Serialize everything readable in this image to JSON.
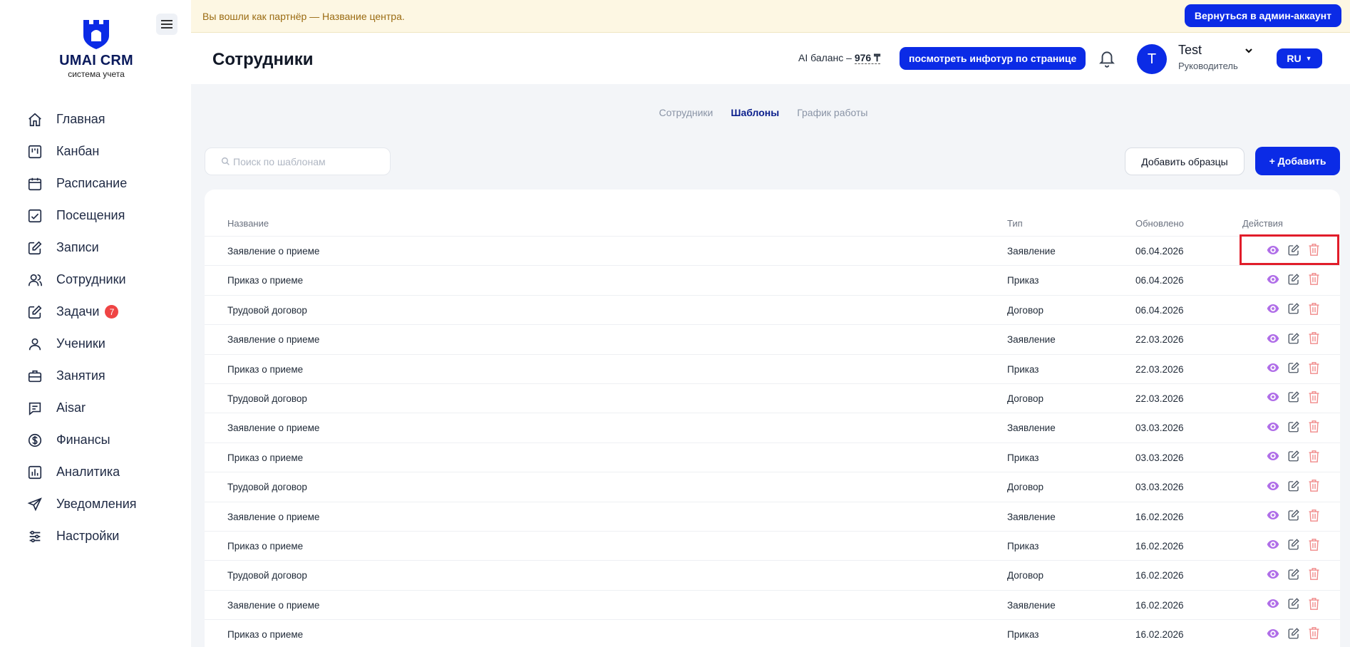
{
  "banner": {
    "text": "Вы вошли как партнёр — Название центра.",
    "back_button": "Вернуться в админ-аккаунт"
  },
  "logo": {
    "title": "UMAI CRM",
    "subtitle": "система учета"
  },
  "sidebar": {
    "items": [
      {
        "label": "Главная",
        "icon": "home-icon"
      },
      {
        "label": "Канбан",
        "icon": "kanban-icon"
      },
      {
        "label": "Расписание",
        "icon": "calendar-icon"
      },
      {
        "label": "Посещения",
        "icon": "calendar-check-icon"
      },
      {
        "label": "Записи",
        "icon": "edit-square-icon"
      },
      {
        "label": "Сотрудники",
        "icon": "users-icon"
      },
      {
        "label": "Задачи",
        "icon": "tasks-icon",
        "badge": "7"
      },
      {
        "label": "Ученики",
        "icon": "user-icon"
      },
      {
        "label": "Занятия",
        "icon": "briefcase-icon"
      },
      {
        "label": "Aisar",
        "icon": "chat-icon"
      },
      {
        "label": "Финансы",
        "icon": "dollar-icon"
      },
      {
        "label": "Аналитика",
        "icon": "bar-chart-icon"
      },
      {
        "label": "Уведомления",
        "icon": "send-icon"
      },
      {
        "label": "Настройки",
        "icon": "sliders-icon"
      }
    ]
  },
  "header": {
    "title": "Сотрудники",
    "ai_balance_label": "AI баланс –",
    "ai_balance_value": "976 ₸",
    "tour_button": "посмотреть инфотур по странице",
    "user": {
      "initial": "T",
      "name": "Test",
      "role": "Руководитель"
    },
    "language": "RU"
  },
  "tabs": [
    {
      "label": "Сотрудники",
      "active": false
    },
    {
      "label": "Шаблоны",
      "active": true
    },
    {
      "label": "График работы",
      "active": false
    }
  ],
  "search": {
    "placeholder": "Поиск по шаблонам",
    "value": ""
  },
  "buttons": {
    "add_samples": "Добавить образцы",
    "add": "+ Добавить"
  },
  "table": {
    "columns": [
      "Название",
      "Тип",
      "Обновлено",
      "Действия"
    ],
    "rows": [
      {
        "name": "Заявление о приеме",
        "type": "Заявление",
        "updated": "06.04.2026"
      },
      {
        "name": "Приказ о приеме",
        "type": "Приказ",
        "updated": "06.04.2026"
      },
      {
        "name": "Трудовой договор",
        "type": "Договор",
        "updated": "06.04.2026"
      },
      {
        "name": "Заявление о приеме",
        "type": "Заявление",
        "updated": "22.03.2026"
      },
      {
        "name": "Приказ о приеме",
        "type": "Приказ",
        "updated": "22.03.2026"
      },
      {
        "name": "Трудовой договор",
        "type": "Договор",
        "updated": "22.03.2026"
      },
      {
        "name": "Заявление о приеме",
        "type": "Заявление",
        "updated": "03.03.2026"
      },
      {
        "name": "Приказ о приеме",
        "type": "Приказ",
        "updated": "03.03.2026"
      },
      {
        "name": "Трудовой договор",
        "type": "Договор",
        "updated": "03.03.2026"
      },
      {
        "name": "Заявление о приеме",
        "type": "Заявление",
        "updated": "16.02.2026"
      },
      {
        "name": "Приказ о приеме",
        "type": "Приказ",
        "updated": "16.02.2026"
      },
      {
        "name": "Трудовой договор",
        "type": "Договор",
        "updated": "16.02.2026"
      },
      {
        "name": "Заявление о приеме",
        "type": "Заявление",
        "updated": "16.02.2026"
      },
      {
        "name": "Приказ о приеме",
        "type": "Приказ",
        "updated": "16.02.2026"
      }
    ]
  },
  "colors": {
    "primary": "#0b2be6",
    "view_icon": "#b06ee8",
    "edit_icon": "#4b5563",
    "delete_icon": "#f08a8a",
    "highlight_box": "#e11d2a",
    "badge": "#ef4444"
  }
}
